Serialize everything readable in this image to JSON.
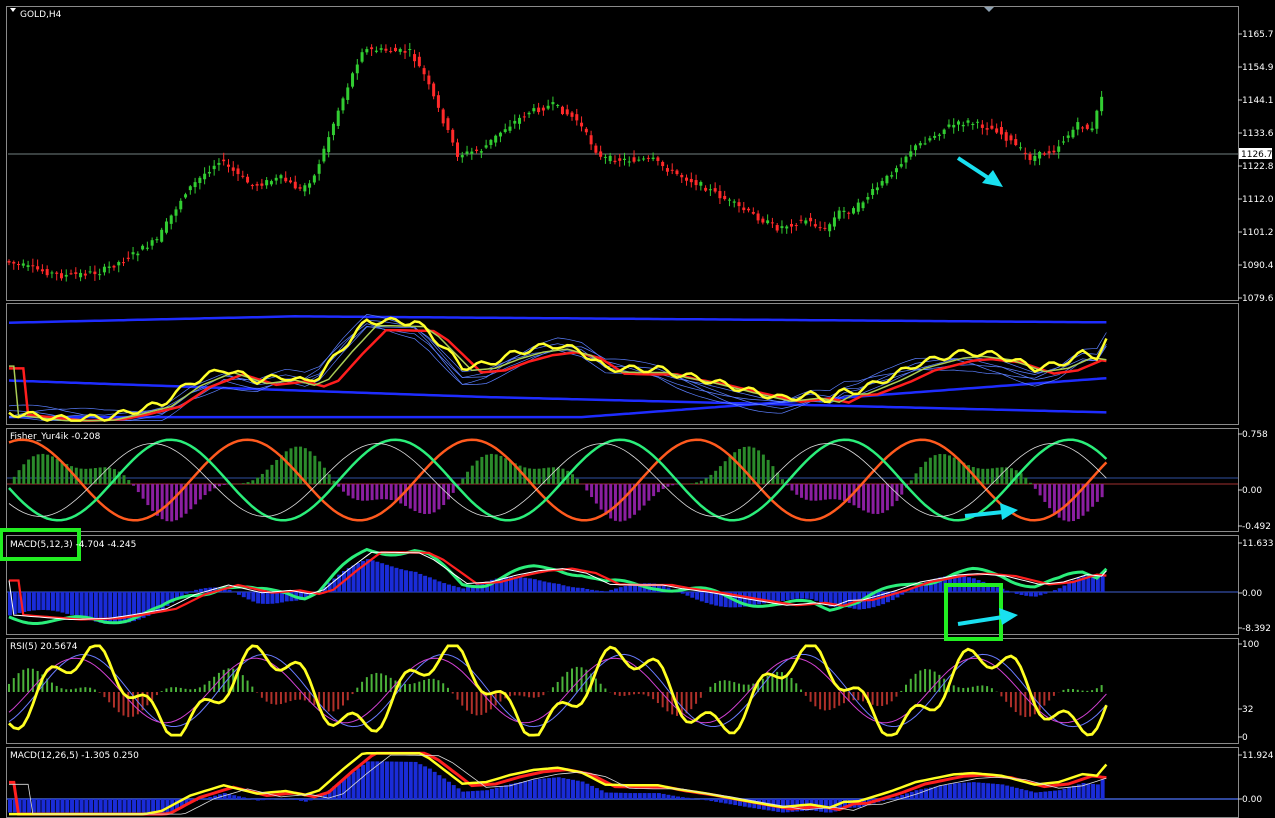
{
  "symbol_title": "GOLD,H4",
  "price_panel": {
    "ticks": [
      "1165.7",
      "1154.9",
      "1144.1",
      "1133.6",
      "1122.8",
      "1112.0",
      "1101.2",
      "1090.4",
      "1079.6"
    ],
    "current_price": "1126.7"
  },
  "indicators": [
    {
      "id": "ma_ribbon",
      "label": ""
    },
    {
      "id": "fisher",
      "label": "Fisher_Yur4ik -0.208",
      "ticks": [
        "0.758",
        "0.00",
        "-0.492"
      ]
    },
    {
      "id": "macd_fast",
      "label": "MACD(5,12,3) -4.704 -4.245",
      "ticks": [
        "11.633",
        "0.00",
        "-8.392"
      ]
    },
    {
      "id": "rsi",
      "label": "RSI(5) 20.5674",
      "ticks": [
        "100",
        "32",
        "0"
      ]
    },
    {
      "id": "macd_slow",
      "label": "MACD(12,26,5) -1.305 0.250",
      "ticks": [
        "11.924",
        "0.00"
      ]
    }
  ],
  "colors": {
    "background": "#000000",
    "bull_candle": "#32cd32",
    "bear_candle": "#ff2a2a",
    "annotation_arrow": "#19e0f0",
    "highlight_box": "#22ee22",
    "grid_line": "#ffffff"
  },
  "annotations": {
    "arrows": [
      "price-down-arrow",
      "fisher-arrow",
      "macd-arrow"
    ],
    "boxes": [
      "macd-label-box",
      "macd-divergence-box"
    ]
  }
}
